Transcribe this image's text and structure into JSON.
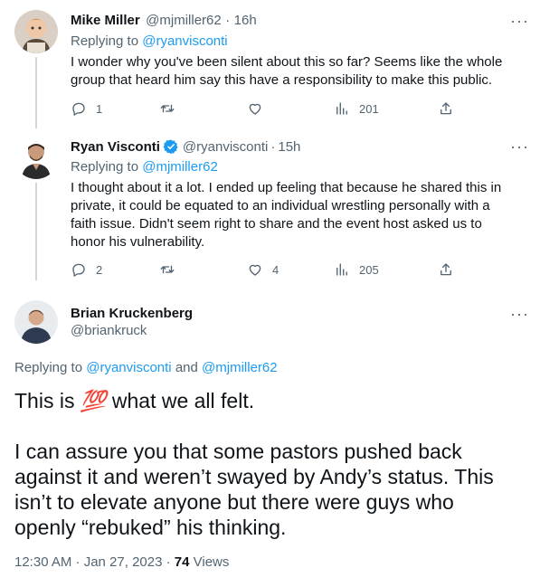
{
  "tweets": [
    {
      "name": "Mike Miller",
      "handle": "@mjmiller62",
      "dot": "·",
      "time": "16h",
      "replying_prefix": "Replying to ",
      "replying_to": "@ryanvisconti",
      "text_lines": [
        "I wonder why you've been silent about this so far?  Seems like the whole",
        "group that heard him say this have a responsibility to make this public."
      ],
      "replies": "1",
      "retweets": "",
      "likes": "",
      "views": "201"
    },
    {
      "name": "Ryan Visconti",
      "handle": "@ryanvisconti",
      "dot": "·",
      "time": "15h",
      "replying_prefix": "Replying to ",
      "replying_to": "@mjmiller62",
      "text_lines": [
        "I thought about it a lot. I ended up feeling that because he shared this in",
        "private, it could be equated to an individual wrestling personally with a",
        "faith issue. Didn't seem right to share and the event host asked us to",
        "honor his vulnerability."
      ],
      "replies": "2",
      "retweets": "",
      "likes": "4",
      "views": "205"
    }
  ],
  "main_tweet": {
    "name": "Brian Kruckenberg",
    "handle": "@briankruck",
    "replying_prefix": "Replying to ",
    "replying_to_1": "@ryanvisconti",
    "replying_and": " and ",
    "replying_to_2": "@mjmiller62",
    "line1_before": "This is ",
    "line1_emoji": "💯",
    "line1_after": " what we all felt.",
    "paragraph_lines": [
      "I can assure you that some pastors pushed back",
      "against it and weren’t swayed by Andy’s status. This",
      "isn’t to elevate anyone but there were guys who",
      "openly “rebuked” his thinking."
    ],
    "timestamp": "12:30 AM · Jan 27, 2023 · ",
    "views_count": "74",
    "views_label": " Views"
  },
  "more_label": "···",
  "icons": {
    "reply": "reply-icon",
    "retweet": "retweet-icon",
    "like": "heart-icon",
    "views": "views-icon",
    "share": "share-icon",
    "verified": "verified-badge-icon"
  },
  "colors": {
    "link": "#1d9bf0",
    "muted": "#536471",
    "line": "#cfd9de",
    "text": "#0f1419"
  }
}
